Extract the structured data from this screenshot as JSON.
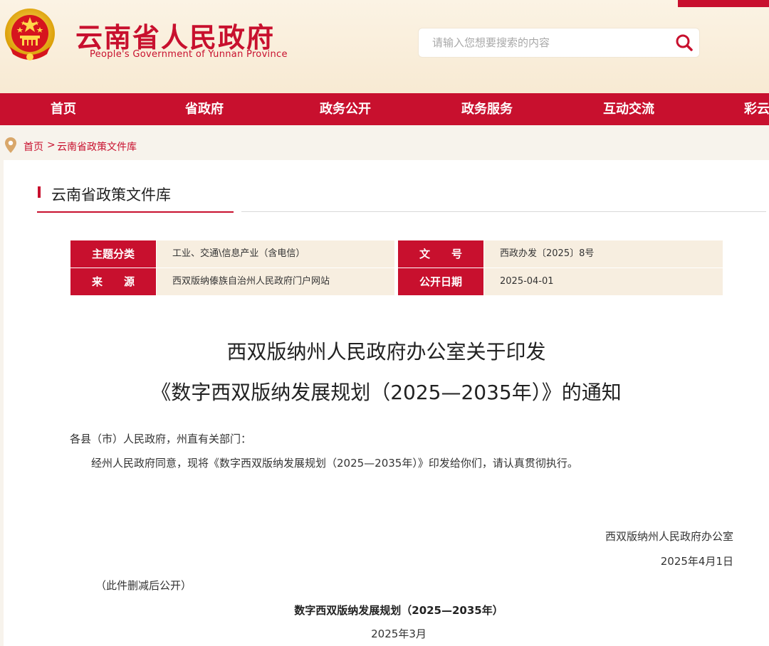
{
  "site": {
    "title": "云南省人民政府",
    "subtitle": "People's Government of Yunnan Province"
  },
  "search": {
    "placeholder": "请输入您想要搜索的内容"
  },
  "nav": {
    "items": [
      "首页",
      "省政府",
      "政务公开",
      "政务服务",
      "互动交流",
      "彩云"
    ]
  },
  "breadcrumb": {
    "home": "首页",
    "separator": ">",
    "current": "云南省政策文件库"
  },
  "section": {
    "title": "云南省政策文件库"
  },
  "meta": {
    "topic_label": "主题分类",
    "topic_value": "工业、交通\\信息产业（含电信）",
    "docno_label": "文　　号",
    "docno_value": "西政办发〔2025〕8号",
    "source_label": "来　　源",
    "source_value": "西双版纳傣族自治州人民政府门户网站",
    "date_label": "公开日期",
    "date_value": "2025-04-01"
  },
  "document": {
    "title_line1": "西双版纳州人民政府办公室关于印发",
    "title_line2": "《数字西双版纳发展规划（2025—2035年）》的通知",
    "salutation": "各县（市）人民政府，州直有关部门：",
    "paragraph1": "经州人民政府同意，现将《数字西双版纳发展规划（2025—2035年）》印发给你们，请认真贯彻执行。",
    "signature_org": "西双版纳州人民政府办公室",
    "signature_date": "2025年4月1日",
    "note": "（此件删减后公开）",
    "attachment_title": "数字西双版纳发展规划（2025—2035年）",
    "attachment_date": "2025年3月"
  },
  "colors": {
    "brand_red": "#c8102e",
    "header_bg": "#f8ead3",
    "meta_value_bg": "#f7eee0",
    "emblem_gold": "#f3c11a"
  }
}
